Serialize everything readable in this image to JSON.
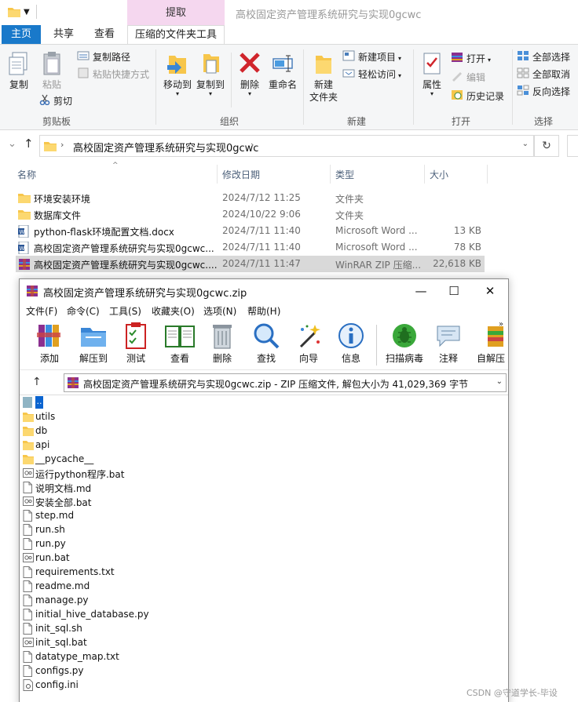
{
  "window": {
    "title": "高校固定资产管理系统研究与实现0gcwc",
    "context_tab": "提取"
  },
  "ribbon_tabs": [
    "主页",
    "共享",
    "查看",
    "压缩的文件夹工具"
  ],
  "ribbon": {
    "clipboard": {
      "copy": "复制",
      "paste": "粘贴",
      "copy_path": "复制路径",
      "paste_shortcut": "粘贴快捷方式",
      "cut": "剪切",
      "group": "剪贴板"
    },
    "organize": {
      "move_to": "移动到",
      "copy_to": "复制到",
      "delete": "删除",
      "rename": "重命名",
      "group": "组织"
    },
    "new": {
      "new_folder_line1": "新建",
      "new_folder_line2": "文件夹",
      "new_item": "新建项目",
      "easy_access": "轻松访问",
      "group": "新建"
    },
    "open": {
      "properties": "属性",
      "open": "打开",
      "edit": "编辑",
      "history": "历史记录",
      "group": "打开"
    },
    "select": {
      "select_all": "全部选择",
      "select_none": "全部取消",
      "invert": "反向选择",
      "group": "选择"
    }
  },
  "address": {
    "path": "高校固定资产管理系统研究与实现0gcwc"
  },
  "file_list": {
    "columns": {
      "name": "名称",
      "date": "修改日期",
      "type": "类型",
      "size": "大小"
    },
    "rows": [
      {
        "name": "环境安装环境",
        "date": "2024/7/12 11:25",
        "type": "文件夹",
        "size": "",
        "icon": "folder-icon"
      },
      {
        "name": "数据库文件",
        "date": "2024/10/22 9:06",
        "type": "文件夹",
        "size": "",
        "icon": "folder-icon"
      },
      {
        "name": "python-flask环境配置文档.docx",
        "date": "2024/7/11 11:40",
        "type": "Microsoft Word ...",
        "size": "13 KB",
        "icon": "word-icon"
      },
      {
        "name": "高校固定资产管理系统研究与实现0gcwc...",
        "date": "2024/7/11 11:40",
        "type": "Microsoft Word ...",
        "size": "78 KB",
        "icon": "word-icon"
      },
      {
        "name": "高校固定资产管理系统研究与实现0gcwc....",
        "date": "2024/7/11 11:47",
        "type": "WinRAR ZIP 压缩...",
        "size": "22,618 KB",
        "icon": "winrar-icon"
      }
    ]
  },
  "rar": {
    "title": "高校固定资产管理系统研究与实现0gcwc.zip",
    "menu": [
      "文件(F)",
      "命令(C)",
      "工具(S)",
      "收藏夹(O)",
      "选项(N)",
      "帮助(H)"
    ],
    "toolbar": [
      "添加",
      "解压到",
      "测试",
      "查看",
      "删除",
      "查找",
      "向导",
      "信息",
      "扫描病毒",
      "注释",
      "自解压"
    ],
    "path": "高校固定资产管理系统研究与实现0gcwc.zip - ZIP 压缩文件, 解包大小为 41,029,369 字节",
    "updir": "..",
    "items": [
      {
        "name": "utils",
        "icon": "folder-icon"
      },
      {
        "name": "db",
        "icon": "folder-icon"
      },
      {
        "name": "api",
        "icon": "folder-icon"
      },
      {
        "name": "__pycache__",
        "icon": "folder-icon"
      },
      {
        "name": "运行python程序.bat",
        "icon": "bat-icon"
      },
      {
        "name": "说明文档.md",
        "icon": "file-icon"
      },
      {
        "name": "安装全部.bat",
        "icon": "bat-icon"
      },
      {
        "name": "step.md",
        "icon": "file-icon"
      },
      {
        "name": "run.sh",
        "icon": "file-icon"
      },
      {
        "name": "run.py",
        "icon": "file-icon"
      },
      {
        "name": "run.bat",
        "icon": "bat-icon"
      },
      {
        "name": "requirements.txt",
        "icon": "file-icon"
      },
      {
        "name": "readme.md",
        "icon": "file-icon"
      },
      {
        "name": "manage.py",
        "icon": "file-icon"
      },
      {
        "name": "initial_hive_database.py",
        "icon": "file-icon"
      },
      {
        "name": "init_sql.sh",
        "icon": "file-icon"
      },
      {
        "name": "init_sql.bat",
        "icon": "bat-icon"
      },
      {
        "name": "datatype_map.txt",
        "icon": "file-icon"
      },
      {
        "name": "configs.py",
        "icon": "file-icon"
      },
      {
        "name": "config.ini",
        "icon": "ini-icon"
      }
    ]
  },
  "watermark": "CSDN @守道学长-毕设"
}
